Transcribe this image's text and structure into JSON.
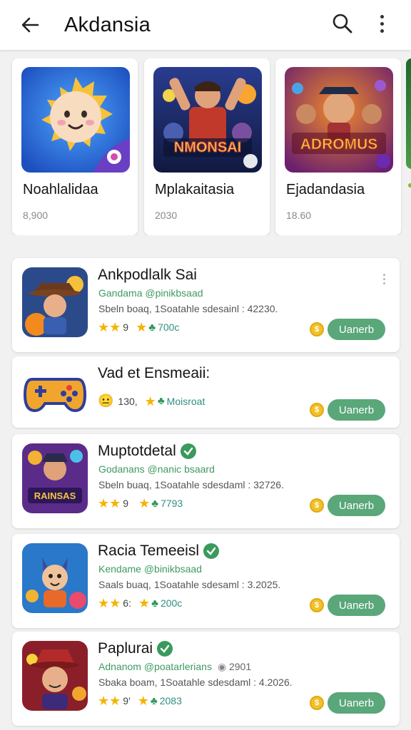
{
  "appbar": {
    "title": "Akdansia",
    "back_icon": "arrow-left-icon",
    "search_icon": "search-icon",
    "more_icon": "more-vert-icon"
  },
  "featured": [
    {
      "name": "Noahlalidaa",
      "meta": "8,900"
    },
    {
      "name": "Mplakaitasia",
      "meta": "2030"
    },
    {
      "name": "Ejadandasia",
      "meta": "18.60"
    }
  ],
  "featured_art_text": [
    "NMONSAI",
    "ADROMUS"
  ],
  "list": [
    {
      "name": "Ankpodlalk Sai",
      "verified": false,
      "developer": "Gandama @pinikbsaad",
      "description": "Sbeln boaq, 1Soatahle sdesainl : 42230.",
      "rating": "9",
      "downloads": "700c",
      "install_label": "Uanerb",
      "show_more": true
    },
    {
      "name": "Vad et Ensmeaii:",
      "verified": false,
      "developer": "",
      "description": "",
      "rating": "130,",
      "downloads": "Moisroat",
      "install_label": "Uanerb",
      "show_more": false
    },
    {
      "name": "Muptotdetal",
      "verified": true,
      "developer": "Godanans @nanic bsaard",
      "description": "Sbeln buaq, 1Soatahle sdesdaml : 32726.",
      "rating": "9",
      "downloads": "7793",
      "install_label": "Uanerb",
      "show_more": false
    },
    {
      "name": "Racia Temeeisl",
      "verified": true,
      "developer": "Kendame @binikbsaad",
      "description": "Saals buaq, 1Soatahle sdesaml : 3.2025.",
      "rating": "6:",
      "downloads": "200c",
      "install_label": "Uanerb",
      "show_more": false
    },
    {
      "name": "Paplurai",
      "verified": true,
      "developer": "Adnanom @poatarlerians",
      "developer_extra": "2901",
      "description": "Sbaka boam, 1Soatahle sdesdaml : 4.2026.",
      "rating": "9'",
      "downloads": "2083",
      "install_label": "Uanerb",
      "show_more": false
    }
  ],
  "colors": {
    "accent_green": "#5aa77a",
    "developer_green": "#3f9a62",
    "star": "#f4b400",
    "background": "#f1f1f1"
  }
}
